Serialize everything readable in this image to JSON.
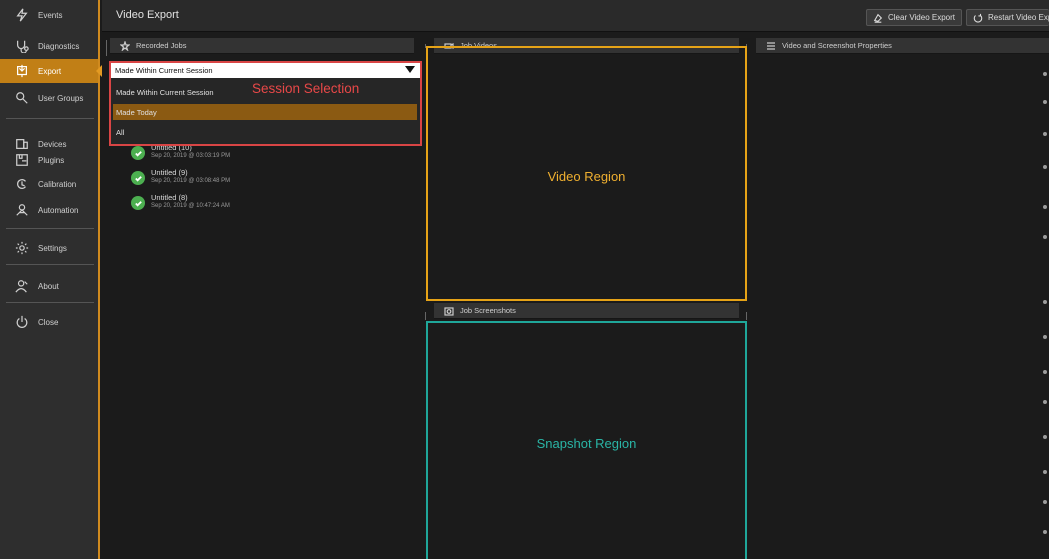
{
  "sidebar": {
    "items": [
      {
        "label": "Events",
        "icon": "lightning-icon"
      },
      {
        "label": "Diagnostics",
        "icon": "stethoscope-icon"
      },
      {
        "label": "Export",
        "icon": "export-icon"
      },
      {
        "label": "User Groups",
        "icon": "user-groups-icon"
      },
      {
        "label": "Devices",
        "icon": "devices-icon"
      },
      {
        "label": "Plugins",
        "icon": "plugin-icon"
      },
      {
        "label": "Calibration",
        "icon": "calibration-icon"
      },
      {
        "label": "Automation",
        "icon": "automation-icon"
      },
      {
        "label": "Settings",
        "icon": "gear-icon"
      },
      {
        "label": "About",
        "icon": "about-icon"
      },
      {
        "label": "Close",
        "icon": "power-icon"
      }
    ],
    "active": "Export"
  },
  "header": {
    "title": "Video Export",
    "clear_button": "Clear Video Export",
    "restart_button": "Restart Video Export"
  },
  "panels": {
    "recorded_jobs": "Recorded Jobs",
    "job_videos": "Job Videos",
    "properties": "Video and Screenshot Properties",
    "job_screenshots": "Job Screenshots"
  },
  "session": {
    "selected": "Made Within Current Session",
    "options": [
      "Made Within Current Session",
      "Made Today",
      "All"
    ],
    "highlighted": "Made Today",
    "annotation": "Session Selection"
  },
  "jobs": [
    {
      "name": "Untitled (10)",
      "date": "Sep 20, 2019 @ 03:03:19 PM"
    },
    {
      "name": "Untitled (9)",
      "date": "Sep 20, 2019 @ 03:08:48 PM"
    },
    {
      "name": "Untitled (8)",
      "date": "Sep 20, 2019 @ 10:47:24 AM"
    }
  ],
  "regions": {
    "video": "Video Region",
    "snapshot": "Snapshot Region"
  },
  "colors": {
    "accent": "#c17f16",
    "video_border": "#e6a317",
    "snapshot_border": "#1fa79a",
    "annotation": "#e84848",
    "success": "#4caf50"
  }
}
